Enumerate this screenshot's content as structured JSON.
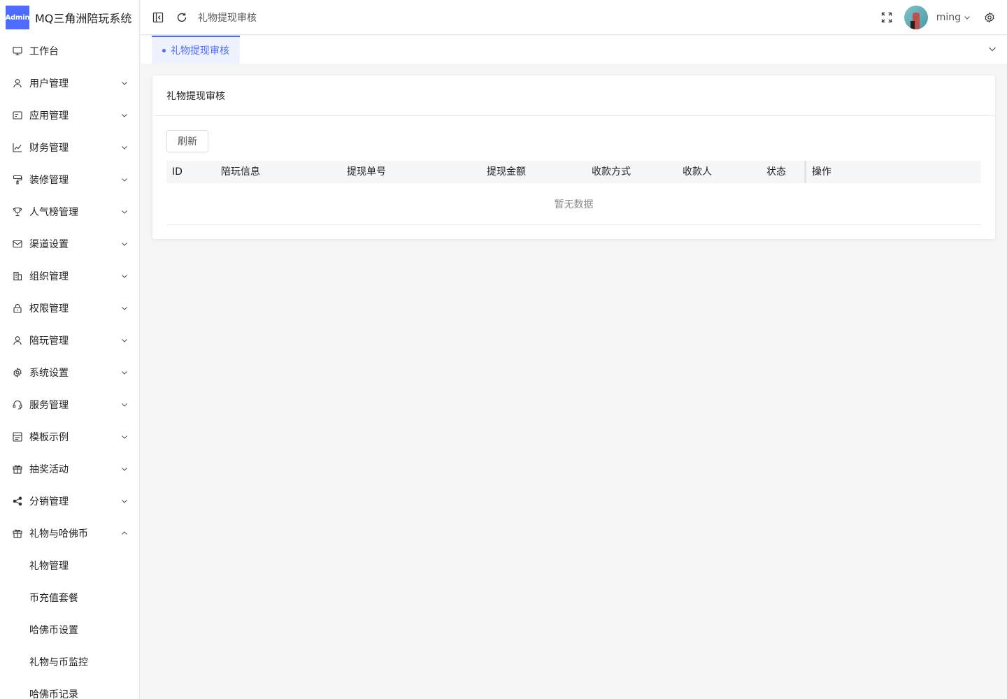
{
  "app": {
    "badge": "Admin",
    "title": "MQ三角洲陪玩系统",
    "accent_color": "#4d6bfe"
  },
  "sidebar": {
    "items": [
      {
        "label": "工作台",
        "icon": "monitor-icon",
        "expandable": false
      },
      {
        "label": "用户管理",
        "icon": "user-icon",
        "expandable": true
      },
      {
        "label": "应用管理",
        "icon": "app-card-icon",
        "expandable": true
      },
      {
        "label": "财务管理",
        "icon": "chart-icon",
        "expandable": true
      },
      {
        "label": "装修管理",
        "icon": "paint-roller-icon",
        "expandable": true
      },
      {
        "label": "人气榜管理",
        "icon": "trophy-icon",
        "expandable": true
      },
      {
        "label": "渠道设置",
        "icon": "mail-icon",
        "expandable": true
      },
      {
        "label": "组织管理",
        "icon": "building-icon",
        "expandable": true
      },
      {
        "label": "权限管理",
        "icon": "lock-icon",
        "expandable": true
      },
      {
        "label": "陪玩管理",
        "icon": "user-icon",
        "expandable": true
      },
      {
        "label": "系统设置",
        "icon": "gear-icon",
        "expandable": true
      },
      {
        "label": "服务管理",
        "icon": "headset-icon",
        "expandable": true
      },
      {
        "label": "模板示例",
        "icon": "template-icon",
        "expandable": true
      },
      {
        "label": "抽奖活动",
        "icon": "gift-icon",
        "expandable": true
      },
      {
        "label": "分销管理",
        "icon": "share-icon",
        "expandable": true
      },
      {
        "label": "礼物与哈佛币",
        "icon": "gift-icon",
        "expandable": true,
        "expanded": true
      }
    ],
    "subitems": [
      {
        "label": "礼物管理"
      },
      {
        "label": "币充值套餐"
      },
      {
        "label": "哈佛币设置"
      },
      {
        "label": "礼物与币监控"
      },
      {
        "label": "哈佛币记录"
      }
    ]
  },
  "header": {
    "breadcrumb": "礼物提现审核",
    "user_name": "ming"
  },
  "tabs": {
    "active": "礼物提现审核"
  },
  "card": {
    "title": "礼物提现审核",
    "refresh_label": "刷新",
    "columns": [
      "ID",
      "陪玩信息",
      "提现单号",
      "提现金额",
      "收款方式",
      "收款人",
      "状态",
      "操作"
    ],
    "empty_text": "暂无数据"
  }
}
